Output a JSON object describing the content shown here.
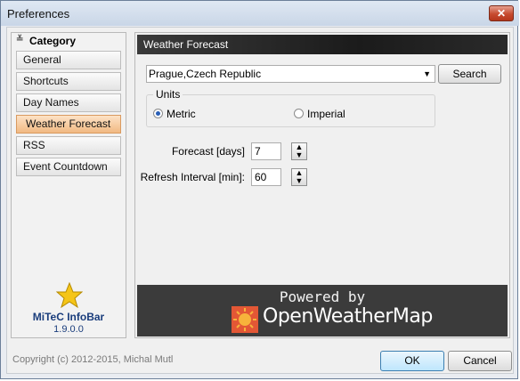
{
  "window": {
    "title": "Preferences",
    "close_glyph": "✕"
  },
  "sidebar": {
    "header": "Category",
    "header_icon": "chevron-double-down-icon",
    "items": [
      {
        "label": "General"
      },
      {
        "label": "Shortcuts"
      },
      {
        "label": "Day Names"
      },
      {
        "label": "Weather Forecast",
        "active": true
      },
      {
        "label": "RSS"
      },
      {
        "label": "Event Countdown"
      }
    ],
    "brand": {
      "name": "MiTeC InfoBar",
      "version": "1.9.0.0",
      "icon": "star-icon"
    }
  },
  "panel": {
    "header": "Weather Forecast",
    "location": {
      "value": "Prague,Czech Republic"
    },
    "search_label": "Search",
    "units": {
      "legend": "Units",
      "options": [
        {
          "label": "Metric",
          "selected": true
        },
        {
          "label": "Imperial",
          "selected": false
        }
      ]
    },
    "forecast": {
      "label": "Forecast [days]",
      "value": "7"
    },
    "refresh": {
      "label": "Refresh Interval [min]:",
      "value": "60"
    },
    "powered": {
      "line1": "Powered by",
      "brand": "OpenWeatherMap",
      "logo_icon": "openweathermap-sun-icon"
    }
  },
  "footer": {
    "copyright": "Copyright (c) 2012-2015, Michal Mutl",
    "ok_label": "OK",
    "cancel_label": "Cancel"
  },
  "colors": {
    "accent": "#f1b982",
    "brand_text": "#1a3d7c",
    "owm_orange": "#e35735",
    "powered_bg": "#3b3b3b"
  }
}
